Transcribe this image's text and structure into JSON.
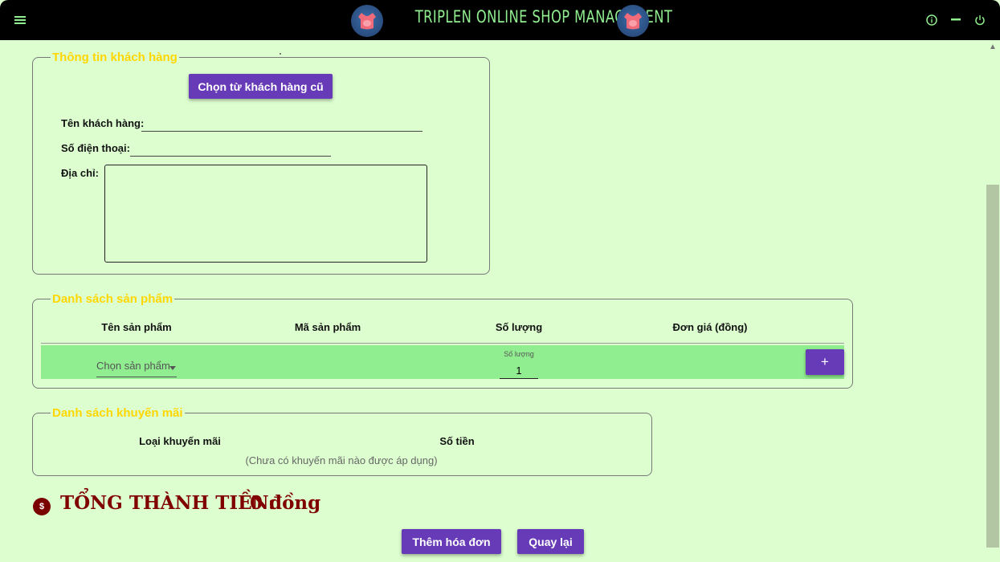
{
  "window": {
    "title": "TRIPLEN ONLINE SHOP MANAGEMENT",
    "icons": [
      "menu-icon",
      "logo-icon",
      "info-icon",
      "minimize-icon",
      "power-icon"
    ],
    "title_color": "#90ee90"
  },
  "customer": {
    "legend": "Thông tin khách hàng",
    "choose_button": "Chọn từ khách hàng cũ",
    "name_label": "Tên khách hàng:",
    "name_value": "",
    "phone_label": "Số điện thoại:",
    "phone_value": "",
    "address_label": "Địa chỉ:",
    "address_value": ""
  },
  "products": {
    "legend": "Danh sách sản phẩm",
    "columns": [
      "Tên sản phẩm",
      "Mã sản phẩm",
      "Số lượng",
      "Đơn giá (đồng)"
    ],
    "row": {
      "select_placeholder": "Chọn sản phẩm",
      "quantity_label": "Số lượng",
      "quantity_value": "1",
      "add_label": "+"
    },
    "row_color": "#90ee90"
  },
  "promotions": {
    "legend": "Danh sách khuyến mãi",
    "columns": [
      "Loại khuyến mãi",
      "Số tiền"
    ],
    "empty_message": "(Chưa có khuyến mãi nào được áp dụng)"
  },
  "total": {
    "label": "TỔNG THÀNH TIỀN:",
    "value": "0 đồng",
    "icon_text": "$",
    "color": "#800000"
  },
  "actions": {
    "add_invoice": "Thêm hóa đơn",
    "back": "Quay lại"
  },
  "colors": {
    "accent": "#673ab7",
    "legend": "#ffd700",
    "background": "#ddffd0"
  }
}
